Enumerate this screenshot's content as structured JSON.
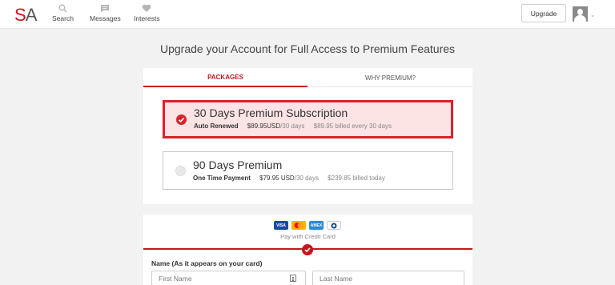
{
  "header": {
    "logo_s": "S",
    "logo_a": "A",
    "nav": [
      {
        "label": "Search",
        "icon": "search-icon"
      },
      {
        "label": "Messages",
        "icon": "chat-icon"
      },
      {
        "label": "Interests",
        "icon": "heart-icon"
      }
    ],
    "upgrade_label": "Upgrade"
  },
  "page": {
    "title": "Upgrade your Account for Full Access to Premium Features"
  },
  "tabs": {
    "packages": "PACKAGES",
    "why_premium": "WHY PREMIUM?"
  },
  "packages": [
    {
      "title": "30 Days Premium Subscription",
      "type": "Auto Renewed",
      "price": "$89.95USD",
      "per": "/30 days",
      "billing": "$89.95 billed every 30 days",
      "selected": true
    },
    {
      "title": "90 Days Premium",
      "type": "One Time Payment",
      "price": "$79.95 USD",
      "per": "/30 days",
      "billing": "$239.85 billed today",
      "selected": false
    }
  ],
  "payment": {
    "cards": [
      "VISA",
      "MC",
      "AMEX",
      "Diners Club"
    ],
    "note": "Pay with Credit Card",
    "name_label": "Name (As it appears on your card)",
    "first_name_placeholder": "First Name",
    "last_name_placeholder": "Last Name"
  },
  "colors": {
    "brand_red": "#c8161d",
    "selected_bg": "#fce4e4"
  }
}
